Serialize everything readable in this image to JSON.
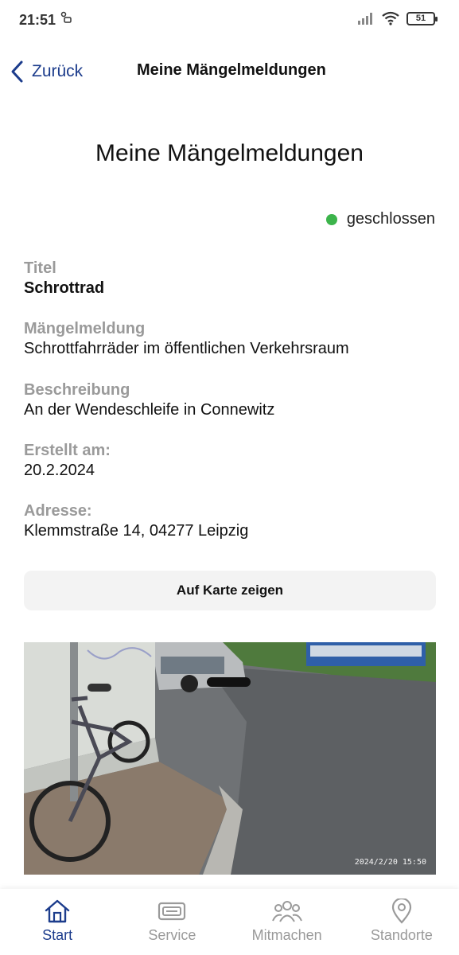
{
  "status_bar": {
    "time": "21:51",
    "battery": "51"
  },
  "header": {
    "back_label": "Zurück",
    "title": "Meine Mängelmeldungen"
  },
  "page_title": "Meine Mängelmeldungen",
  "report": {
    "status": "geschlossen",
    "status_color": "#3cb44b",
    "fields": [
      {
        "label": "Titel",
        "value": "Schrottrad"
      },
      {
        "label": "Mängelmeldung",
        "value": "Schrottfahrräder im öffentlichen Verkehrsraum"
      },
      {
        "label": "Beschreibung",
        "value": "An der Wendeschleife in Connewitz"
      },
      {
        "label": "Erstellt am:",
        "value": "20.2.2024"
      },
      {
        "label": "Adresse:",
        "value": "Klemmstraße 14, 04277 Leipzig"
      }
    ],
    "map_button_label": "Auf Karte zeigen",
    "photo_timestamp": "2024/2/20  15:50"
  },
  "bottom_nav": {
    "items": [
      {
        "label": "Start",
        "icon": "home-icon",
        "active": true
      },
      {
        "label": "Service",
        "icon": "ticket-icon"
      },
      {
        "label": "Mitmachen",
        "icon": "group-icon"
      },
      {
        "label": "Standorte",
        "icon": "location-pin-icon"
      }
    ]
  },
  "colors": {
    "accent": "#1c3c8c",
    "muted": "#9a9a9a"
  }
}
